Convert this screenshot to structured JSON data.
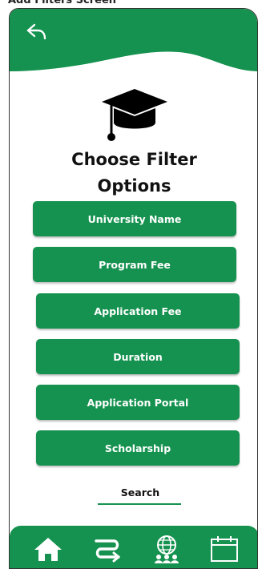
{
  "page": {
    "title": "Add Filters Screen"
  },
  "header": {
    "back_icon": "back-arrow-icon"
  },
  "hero": {
    "icon": "graduation-cap-icon",
    "heading_line1": "Choose Filter",
    "heading_line2": "Options"
  },
  "filters": [
    {
      "label": "University Name"
    },
    {
      "label": "Program Fee"
    },
    {
      "label": "Application Fee"
    },
    {
      "label": "Duration"
    },
    {
      "label": "Application Portal"
    },
    {
      "label": "Scholarship"
    }
  ],
  "search": {
    "label": "Search"
  },
  "bottom_nav": {
    "items": [
      {
        "icon": "home-icon"
      },
      {
        "icon": "route-icon"
      },
      {
        "icon": "globe-people-icon"
      },
      {
        "icon": "calendar-icon"
      }
    ]
  },
  "colors": {
    "primary": "#15924f",
    "text": "#111111",
    "background": "#ffffff"
  }
}
